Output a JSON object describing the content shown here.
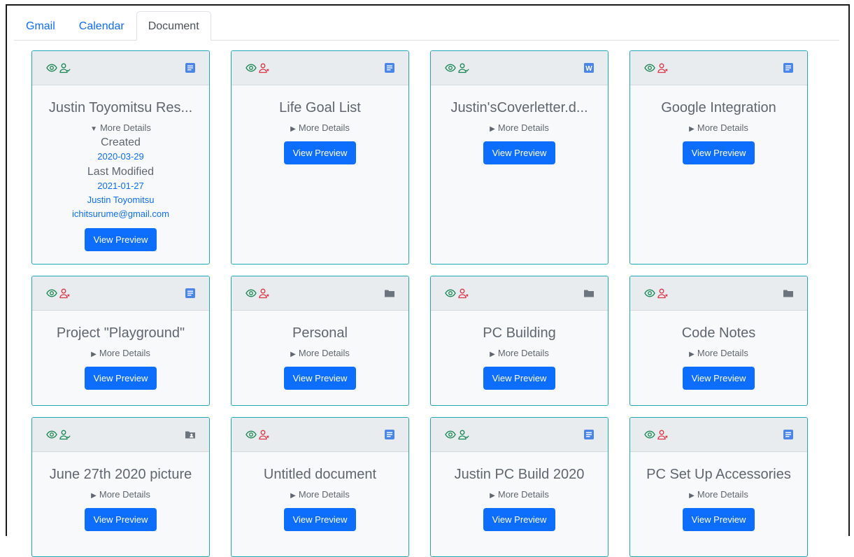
{
  "tabs": [
    {
      "label": "Gmail",
      "active": false
    },
    {
      "label": "Calendar",
      "active": false
    },
    {
      "label": "Document",
      "active": true
    }
  ],
  "colors": {
    "accent": "#0d6efd",
    "card_border": "#20a8b8",
    "viewed": "#198754",
    "shared_yes": "#198754",
    "shared_no": "#dc3545",
    "doc_icon": "#4a86e8",
    "word_icon": "#4a86e8",
    "folder_icon": "#6c757d"
  },
  "common": {
    "more_details": "More Details",
    "view_preview": "View Preview",
    "created_label": "Created",
    "modified_label": "Last Modified"
  },
  "cards": [
    {
      "title": "Justin Toyomitsu Res...",
      "type": "doc-icon",
      "shared": true,
      "expanded": true,
      "created": "2020-03-29",
      "modified": "2021-01-27",
      "owner": "Justin Toyomitsu",
      "email": "ichitsurume@gmail.com"
    },
    {
      "title": "Life Goal List",
      "type": "doc-icon",
      "shared": false
    },
    {
      "title": "Justin'sCoverletter.d...",
      "type": "word-icon",
      "shared": true
    },
    {
      "title": "Google Integration",
      "type": "doc-icon",
      "shared": false
    },
    {
      "title": "Project \"Playground\"",
      "type": "doc-icon",
      "shared": false
    },
    {
      "title": "Personal",
      "type": "folder-icon",
      "shared": false
    },
    {
      "title": "PC Building",
      "type": "folder-icon",
      "shared": false
    },
    {
      "title": "Code Notes",
      "type": "folder-icon",
      "shared": false
    },
    {
      "title": "June 27th 2020 picture",
      "type": "shared-folder-icon",
      "shared": true
    },
    {
      "title": "Untitled document",
      "type": "doc-icon",
      "shared": false
    },
    {
      "title": "Justin PC Build 2020",
      "type": "doc-icon",
      "shared": true
    },
    {
      "title": "PC Set Up Accessories",
      "type": "doc-icon",
      "shared": false
    }
  ]
}
